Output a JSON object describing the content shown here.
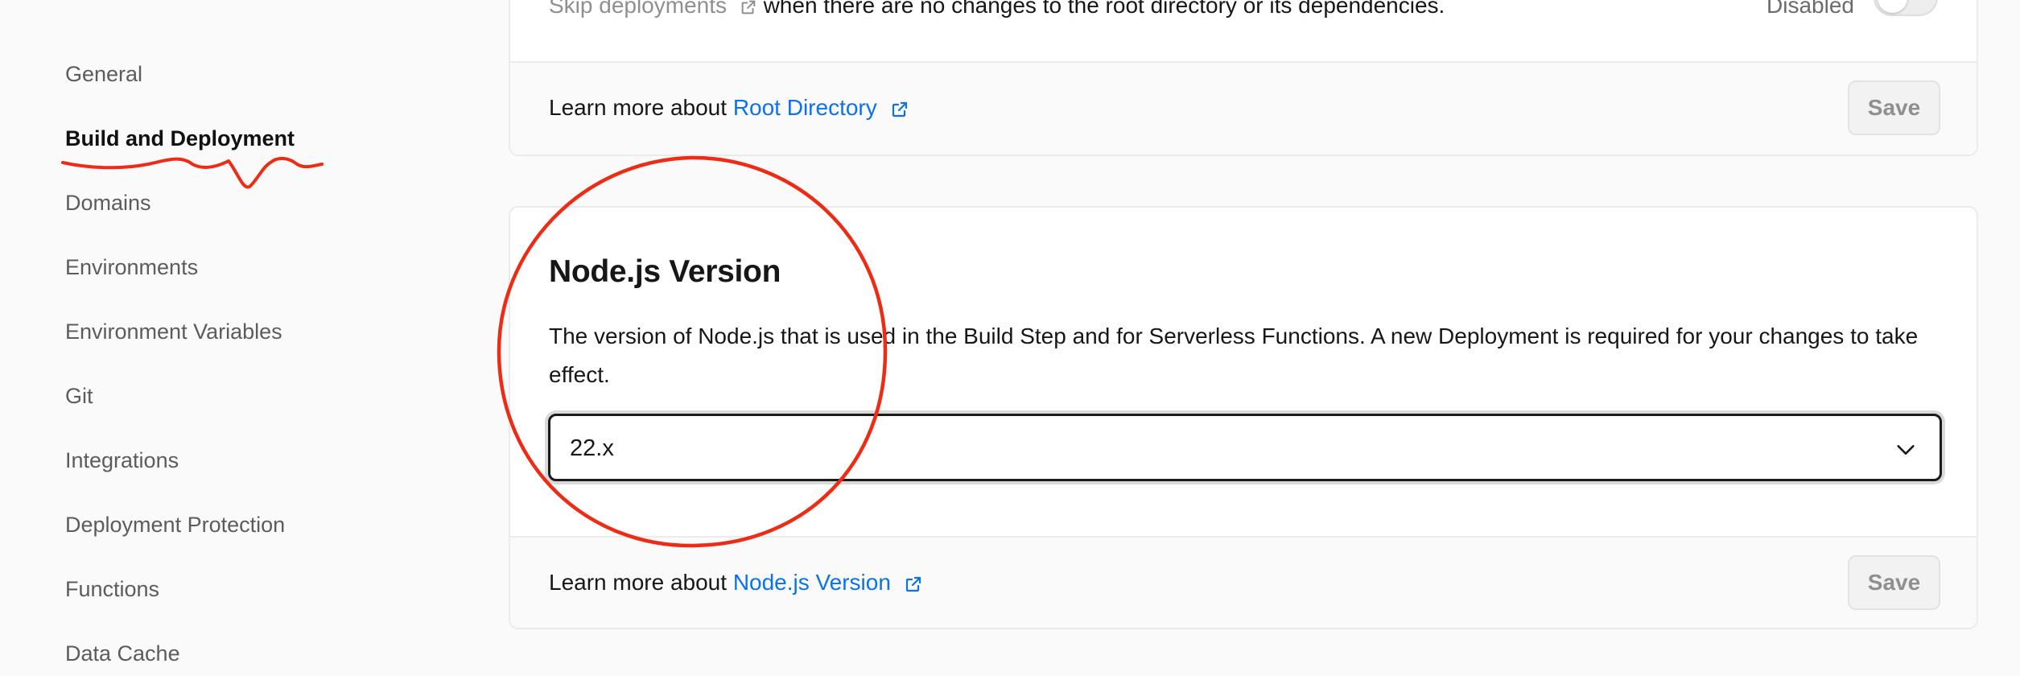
{
  "sidebar": {
    "items": [
      {
        "label": "General"
      },
      {
        "label": "Build and Deployment",
        "active": true
      },
      {
        "label": "Domains"
      },
      {
        "label": "Environments"
      },
      {
        "label": "Environment Variables"
      },
      {
        "label": "Git"
      },
      {
        "label": "Integrations"
      },
      {
        "label": "Deployment Protection"
      },
      {
        "label": "Functions"
      },
      {
        "label": "Data Cache"
      }
    ]
  },
  "root_directory_card": {
    "skip_label": "Skip deployments",
    "skip_suffix": "when there are no changes to the root directory or its dependencies.",
    "toggle_state_label": "Disabled",
    "footer_prefix": "Learn more about ",
    "footer_link": "Root Directory",
    "save_label": "Save"
  },
  "node_card": {
    "title": "Node.js Version",
    "description": "The version of Node.js that is used in the Build Step and for Serverless Functions. A new Deployment is required for your changes to take effect.",
    "selected_version": "22.x",
    "footer_prefix": "Learn more about ",
    "footer_link": "Node.js Version",
    "save_label": "Save"
  },
  "colors": {
    "link": "#0a72ef",
    "annotation": "#ee2b14"
  },
  "icons": [
    "external-link-icon",
    "chevron-down-icon"
  ]
}
